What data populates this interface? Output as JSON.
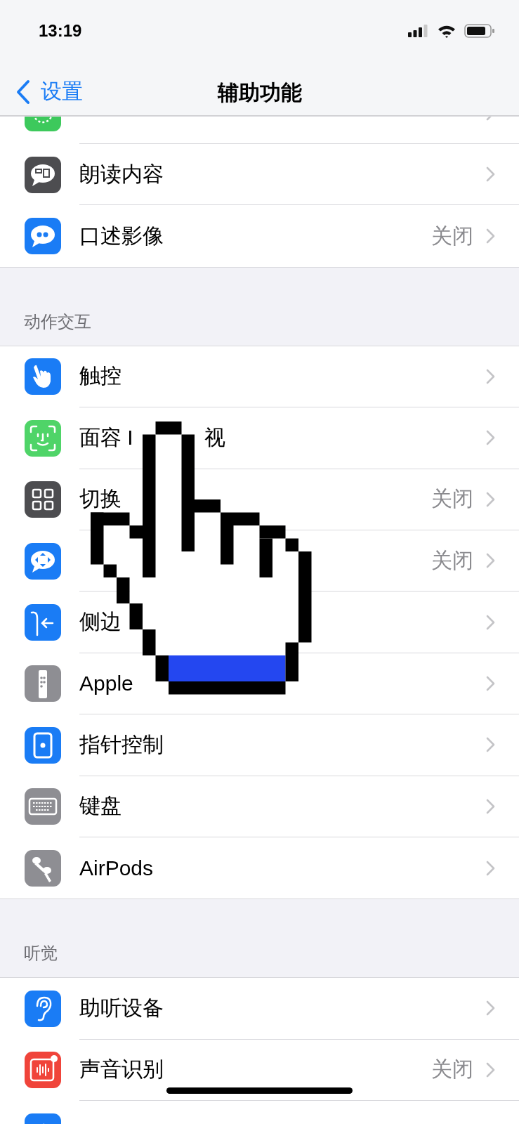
{
  "status_bar": {
    "time": "13:19"
  },
  "nav": {
    "back": "设置",
    "title": "辅助功能"
  },
  "sections": [
    {
      "rows": [
        {
          "kind": "motion"
        },
        {
          "kind": "speak",
          "label": "朗读内容"
        },
        {
          "kind": "quote",
          "label": "口述影像",
          "value": "关闭"
        }
      ]
    },
    {
      "header": "动作交互",
      "rows": [
        {
          "kind": "touch",
          "label": "触控"
        },
        {
          "kind": "face",
          "label": "面容 I",
          "tail": "视"
        },
        {
          "kind": "switch",
          "label": "切换",
          "value": "关闭"
        },
        {
          "kind": "voice",
          "value": "关闭"
        },
        {
          "kind": "side",
          "label": "侧边"
        },
        {
          "kind": "remote",
          "label": "Apple"
        },
        {
          "kind": "pointer",
          "label": "指针控制"
        },
        {
          "kind": "keyboard",
          "label": "键盘"
        },
        {
          "kind": "airpods",
          "label": "AirPods"
        }
      ]
    },
    {
      "header": "听觉",
      "rows": [
        {
          "kind": "ear",
          "label": "助听设备"
        },
        {
          "kind": "sound",
          "label": "声音识别",
          "value": "关闭"
        },
        {
          "kind": "audio"
        }
      ]
    }
  ]
}
